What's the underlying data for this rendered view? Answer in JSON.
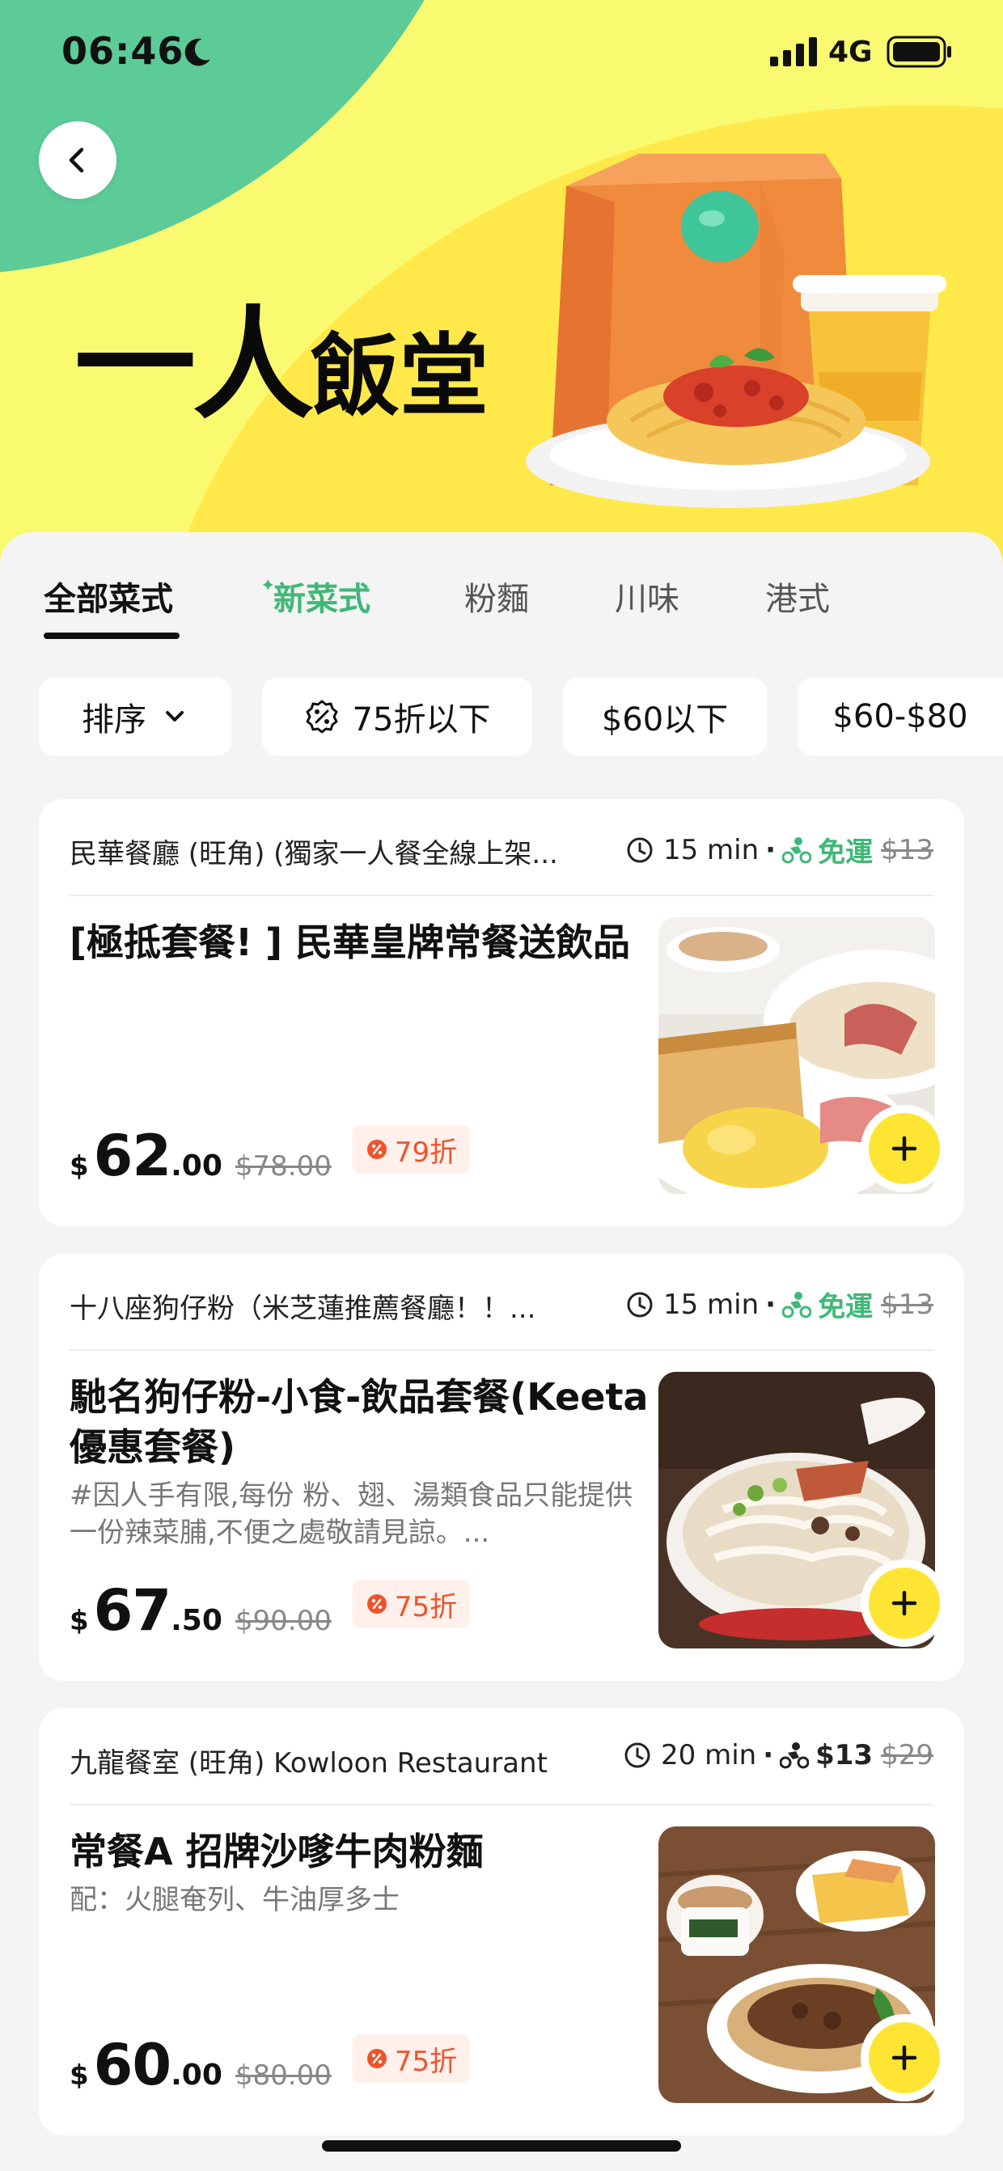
{
  "status_bar": {
    "time": "06:46",
    "network": "4G",
    "icons": [
      "moon-icon",
      "signal-icon",
      "battery-icon"
    ]
  },
  "hero": {
    "title_big": "一人",
    "title_small": "飯堂",
    "colors": {
      "green": "#5ccb98",
      "yellow": "#ffe94a",
      "light_yellow": "#fafa70"
    }
  },
  "tabs": [
    {
      "label": "全部菜式",
      "active": true
    },
    {
      "label": "新菜式",
      "new": true
    },
    {
      "label": "粉麵"
    },
    {
      "label": "川味"
    },
    {
      "label": "港式"
    }
  ],
  "filters": [
    {
      "label": "排序",
      "icon": "chevron-down-icon"
    },
    {
      "label": "75折以下",
      "icon": "discount-badge-icon"
    },
    {
      "label": "$60以下"
    },
    {
      "label": "$60-$80"
    }
  ],
  "cards": [
    {
      "store": "民華餐廳 (旺角) (獨家一人餐全線上架...",
      "eta": "15 min",
      "delivery_fee": "免運",
      "delivery_fee_old": "$13",
      "title": "[極抵套餐! ] 民華皇牌常餐送飲品",
      "description": "",
      "price_currency": "$",
      "price_int": "62",
      "price_dec": ".00",
      "price_old": "$78.00",
      "discount": "79折"
    },
    {
      "store": "十八座狗仔粉（米芝蓮推薦餐廳！！...",
      "eta": "15 min",
      "delivery_fee": "免運",
      "delivery_fee_old": "$13",
      "title": "馳名狗仔粉-小食-飲品套餐(Keeta優惠套餐)",
      "description": "#因人手有限,每份 粉、翅、湯類食品只能提供一份辣菜脯,不便之處敬請見諒。...",
      "price_currency": "$",
      "price_int": "67",
      "price_dec": ".50",
      "price_old": "$90.00",
      "discount": "75折"
    },
    {
      "store": "九龍餐室 (旺角) Kowloon Restaurant",
      "eta": "20 min",
      "delivery_fee": "$13",
      "delivery_fee_old": "$29",
      "title": "常餐A 招牌沙嗲牛肉粉麵",
      "description": "配：火腿奄列、牛油厚多士",
      "price_currency": "$",
      "price_int": "60",
      "price_dec": ".00",
      "price_old": "$80.00",
      "discount": "75折"
    }
  ]
}
